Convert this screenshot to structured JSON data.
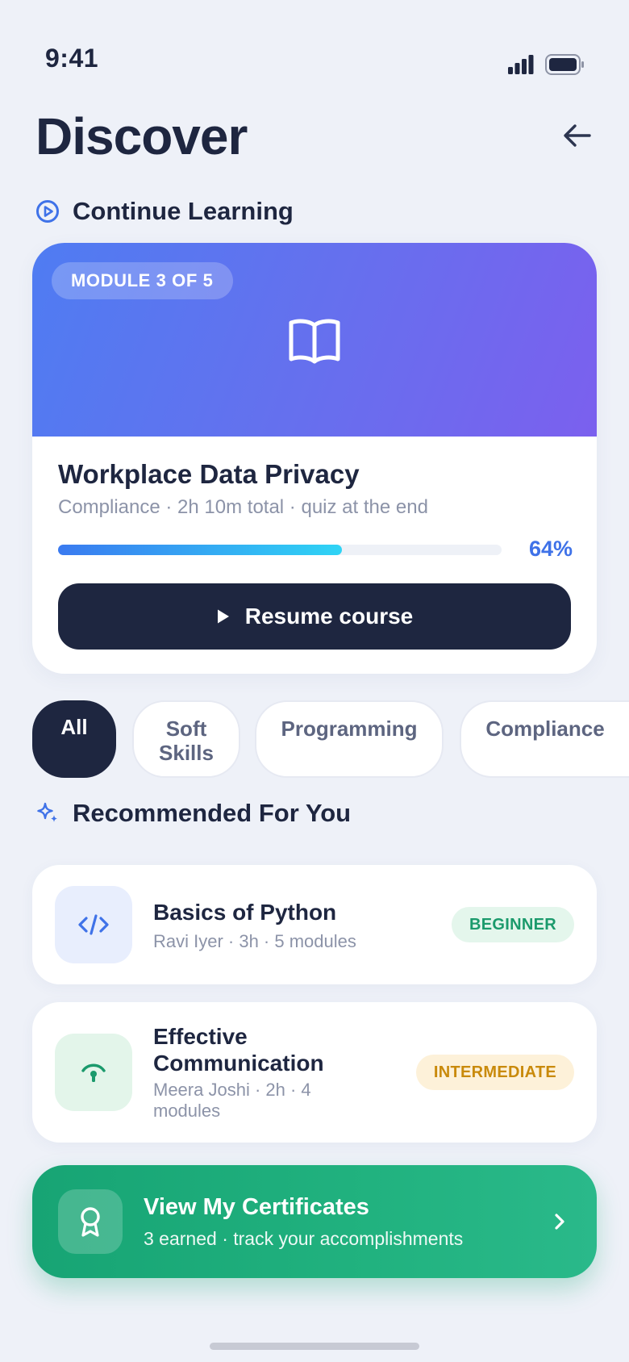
{
  "status_bar": {
    "time": "9:41"
  },
  "header": {
    "title": "Discover",
    "back_icon": "arrow-left-icon"
  },
  "continue_section": {
    "heading": "Continue Learning",
    "icon": "play-circle-icon",
    "course": {
      "module_badge": "MODULE 3 OF 5",
      "title": "Workplace Data Privacy",
      "meta": "Compliance · 2h 10m total · quiz at the end",
      "progress": 0.64,
      "progress_label": "64%",
      "resume_label": "Resume course",
      "colors": {
        "hero_start": "#4f7cf2",
        "hero_end": "#7b60ee",
        "progress_start": "#3a7af0",
        "progress_end": "#2fd4f5"
      }
    }
  },
  "filters": {
    "chips": [
      {
        "label": "All",
        "active": true
      },
      {
        "label": "Soft Skills",
        "line1": "Soft",
        "line2": "Skills",
        "active": false
      },
      {
        "label": "Programming",
        "active": false
      },
      {
        "label": "Compliance",
        "active": false
      }
    ]
  },
  "recommended": {
    "heading": "Recommended For You",
    "icon": "sparkles-icon",
    "items": [
      {
        "title": "Basics of Python",
        "meta": "Ravi Iyer · 3h · 5 modules",
        "level": "BEGINNER",
        "icon": "code-icon"
      },
      {
        "title": "Effective Communication",
        "meta": "Meera Joshi · 2h · 4 modules",
        "level": "INTERMEDIATE",
        "icon": "broadcast-icon"
      }
    ]
  },
  "certificates": {
    "title": "View My Certificates",
    "subtitle": "3 earned · track your accomplishments",
    "icon": "award-icon"
  },
  "colors": {
    "accent": "#3f72e8",
    "dark": "#1e2640",
    "success": "#1aa876",
    "warning": "#c98a0b"
  }
}
